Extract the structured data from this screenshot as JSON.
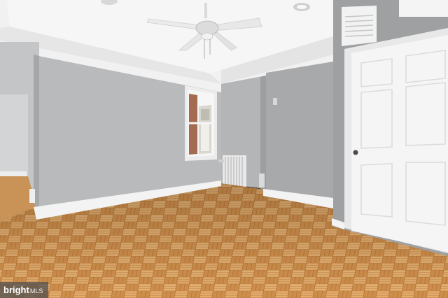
{
  "photo": {
    "subject": "empty-room",
    "colors": {
      "ceiling": "#f1f1f1",
      "wall": "#b8b9ba",
      "wall_shadow": "#a9aaab",
      "trim": "#f3f3f3",
      "floor_light": "#e0a869",
      "floor_dark": "#b97a3e",
      "door": "#f4f4f4"
    }
  },
  "watermark": {
    "brand": "bright",
    "suffix": "MLS"
  }
}
